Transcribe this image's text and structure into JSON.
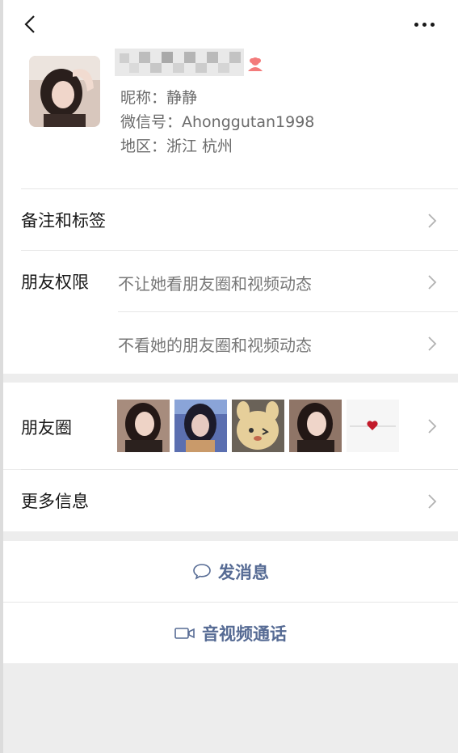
{
  "nav": {
    "back_icon": "chevron-left-icon",
    "more_icon": "more-dots-icon"
  },
  "profile": {
    "name_obscured": true,
    "gender_icon": "female-user-icon",
    "nickname_label": "昵称：",
    "nickname_value": "静静",
    "wechat_id_label": "微信号：",
    "wechat_id_value": "Ahonggutan1998",
    "region_label": "地区：",
    "region_value": "浙江 杭州"
  },
  "rows": {
    "remarks_label": "备注和标签",
    "permissions_label": "朋友权限",
    "permission_1": "不让她看朋友圈和视频动态",
    "permission_2": "不看她的朋友圈和视频动态",
    "moments_label": "朋友圈",
    "more_info_label": "更多信息"
  },
  "moments_thumbnails": [
    "selfie-photo-1",
    "selfie-photo-2",
    "plush-toy-photo",
    "selfie-photo-3",
    "heart-line-image"
  ],
  "actions": {
    "message_label": "发消息",
    "call_label": "音视频通话"
  },
  "colors": {
    "accent": "#566b94",
    "background": "#ededed",
    "gender": "#fa5151"
  }
}
